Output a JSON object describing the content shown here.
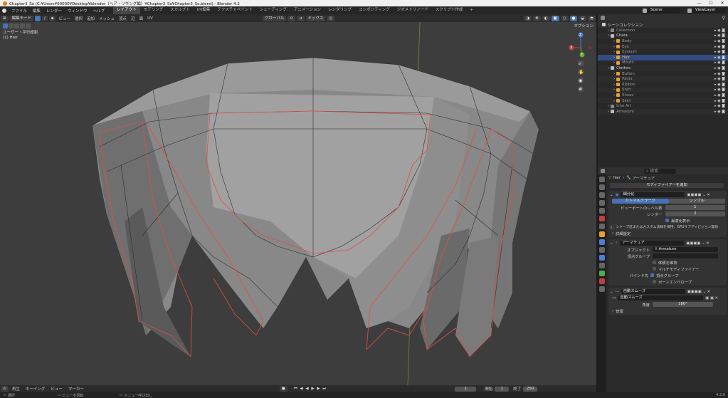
{
  "titlebar": {
    "title": "Chapter3_So (C:¥Users¥00000¥Desktop¥blender（ヘア・リギング編）¥Chapter3_So¥Chapter3_So.blend) - Blender 4.2",
    "min": "—",
    "max": "☐",
    "close": "✕"
  },
  "menu": [
    "ファイル",
    "編集",
    "レンダー",
    "ウィンドウ",
    "ヘルプ"
  ],
  "workspaces": [
    {
      "label": "レイアウト",
      "active": true
    },
    {
      "label": "モデリング"
    },
    {
      "label": "スカルプト"
    },
    {
      "label": "UV編集"
    },
    {
      "label": "テクスチャペイント"
    },
    {
      "label": "シェーディング"
    },
    {
      "label": "アニメーション"
    },
    {
      "label": "レンダリング"
    },
    {
      "label": "コンポジティング"
    },
    {
      "label": "ジオメトリノード"
    },
    {
      "label": "スクリプト作成"
    }
  ],
  "scene": {
    "name": "Scene",
    "viewlayer": "ViewLayer"
  },
  "viewport_header": {
    "mode": "編集モード",
    "menus": [
      "ビュー",
      "選択",
      "追加",
      "メッシュ",
      "頂点",
      "辺",
      "面",
      "UV"
    ],
    "transform": "グローバル",
    "snap": "ミックス",
    "options": "オプション"
  },
  "viewport_info": {
    "view": "ユーザー・平行投影",
    "object": "(1) Hair"
  },
  "gizmo": {
    "z": "Z",
    "y": "Y",
    "x": "X"
  },
  "outliner": {
    "header": "シーンコレクション",
    "items": [
      {
        "label": "Collection",
        "indent": 1,
        "color": "#888888",
        "dim": true
      },
      {
        "label": "Chara",
        "indent": 1,
        "color": "#bbbbbb"
      },
      {
        "label": "Body",
        "indent": 2,
        "color": "#e8a030",
        "dim": true
      },
      {
        "label": "Eye",
        "indent": 2,
        "color": "#e8a030",
        "dim": true
      },
      {
        "label": "Eyelash",
        "indent": 2,
        "color": "#e8a030",
        "dim": true
      },
      {
        "label": "Hair",
        "indent": 2,
        "color": "#e8a030",
        "hl": true
      },
      {
        "label": "Mouth",
        "indent": 2,
        "color": "#e8a030",
        "dim": true
      },
      {
        "label": "Clothes",
        "indent": 1,
        "color": "#bbbbbb"
      },
      {
        "label": "Button",
        "indent": 2,
        "color": "#e8a030",
        "dim": true
      },
      {
        "label": "Pants",
        "indent": 2,
        "color": "#e8a030",
        "dim": true
      },
      {
        "label": "Ribbon",
        "indent": 2,
        "color": "#e8a030",
        "dim": true
      },
      {
        "label": "Shirt",
        "indent": 2,
        "color": "#e8a030",
        "dim": true
      },
      {
        "label": "Shoes",
        "indent": 2,
        "color": "#e8a030",
        "dim": true
      },
      {
        "label": "Skirt",
        "indent": 2,
        "color": "#e8a030",
        "dim": true
      },
      {
        "label": "Line Art",
        "indent": 1,
        "color": "#888888",
        "dim": true
      },
      {
        "label": "Armature",
        "indent": 1,
        "color": "#bbbbbb",
        "dim": true
      }
    ]
  },
  "props": {
    "search_placeholder": "検索",
    "breadcrumb_obj": "Hair",
    "breadcrumb_mod": "アーマチュア",
    "add_modifier": "モディファイアーを追加",
    "subdiv": {
      "name": "細分化",
      "tab_active": "カトマルクラーク",
      "tab2": "シンプル",
      "viewport_levels_label": "ビューポートのレベル数",
      "viewport_levels": "1",
      "render_label": "レンダー",
      "render": "2",
      "optimal_label": "最適化表示",
      "info": "シャープ区またはカスタム法線を保持、GPUサブディビジョン無効",
      "advanced": "詳細設定"
    },
    "armature": {
      "name": "アーマチュア",
      "object_label": "オブジェクト",
      "object": "Armature",
      "vgroup_label": "頂点グループ",
      "keep_volume": "体積を維持",
      "multi_mod": "マルチモディファイアー",
      "bind_label": "バインド先",
      "bind_vgroup": "頂点グループ",
      "bind_envelope": "ボーンエンベロープ"
    },
    "smooth": {
      "name": "自動スムーズ",
      "node": "自動スムーズ",
      "angle_label": "角度",
      "angle": "180°",
      "manage": "管理"
    }
  },
  "timeline": {
    "playback": "再生",
    "keying": "キーイング",
    "view": "ビュー",
    "marker": "マーカー",
    "current": "1",
    "start_label": "開始",
    "start": "1",
    "end_label": "終了",
    "end": "250"
  },
  "status": {
    "select": "選択",
    "rotate": "ビューを回転",
    "menu": "メニュー呼び出し",
    "version": "4.2.0"
  }
}
